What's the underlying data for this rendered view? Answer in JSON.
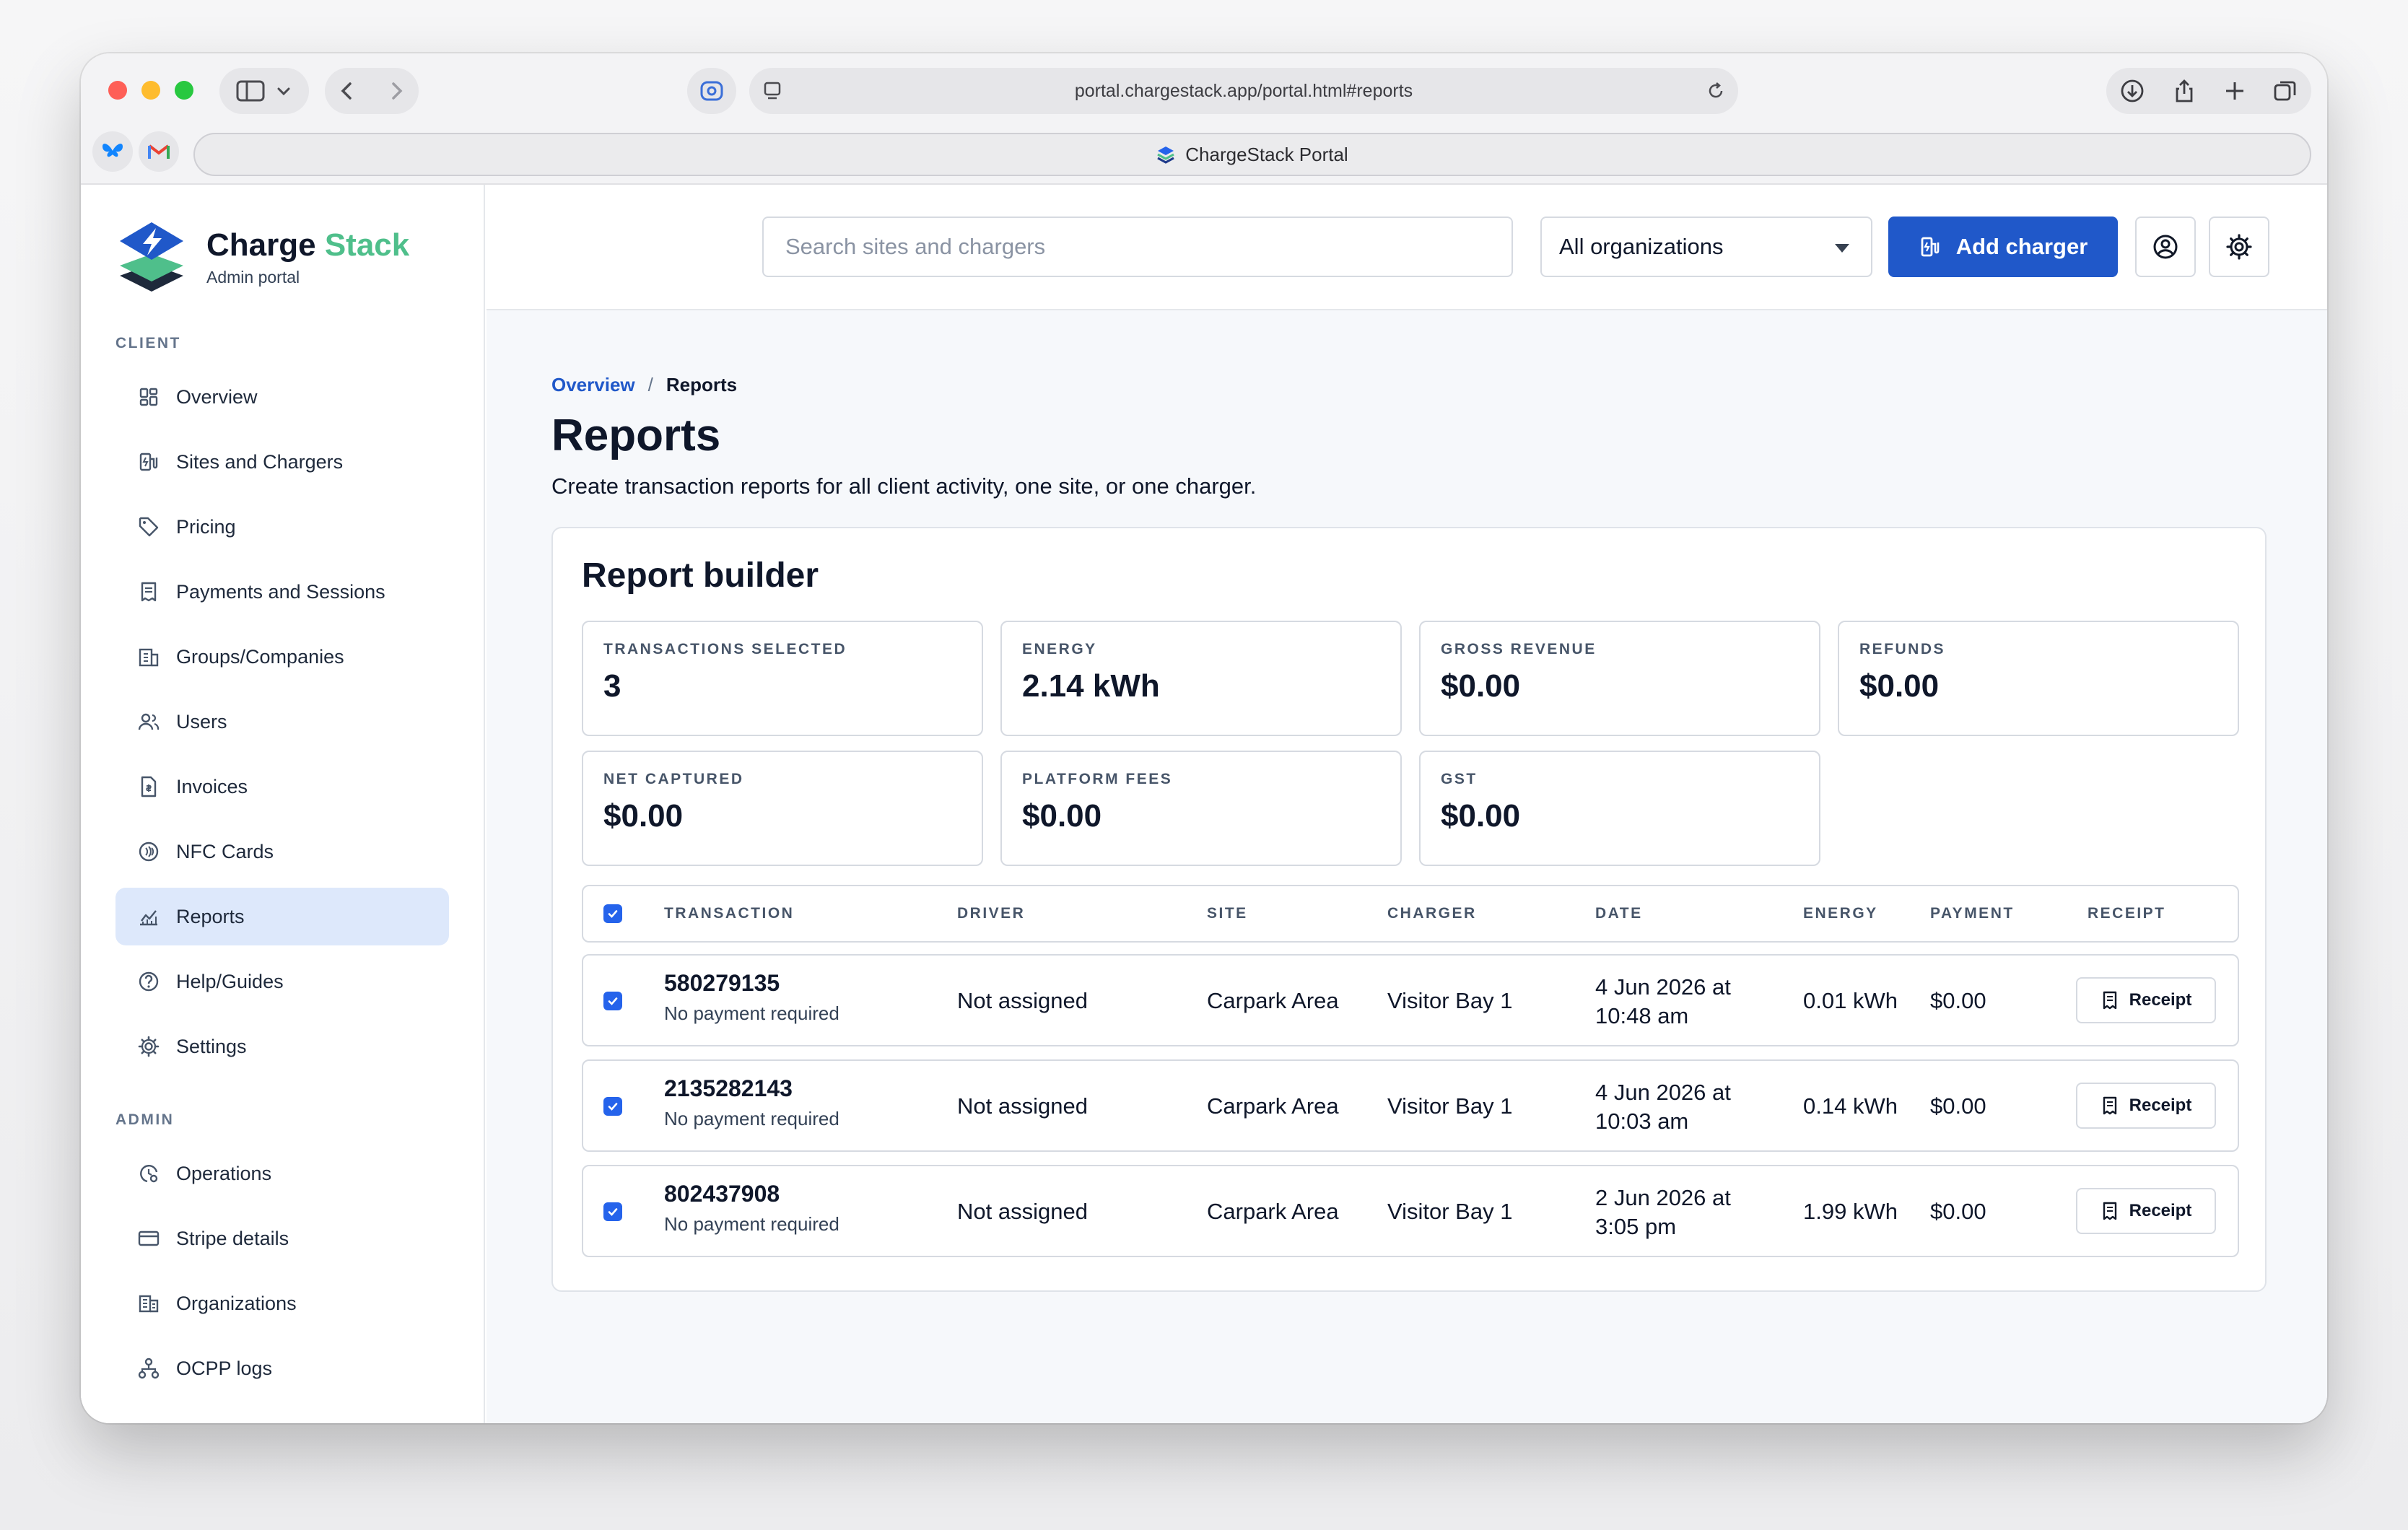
{
  "browser": {
    "url": "portal.chargestack.app/portal.html#reports",
    "tab_title": "ChargeStack Portal"
  },
  "brand": {
    "name_part1": "Charge",
    "name_part2": "Stack",
    "subtitle": "Admin portal",
    "accent_color": "#4fbf8b",
    "logo_icon": "layered-bolt-logo-icon"
  },
  "sidebar": {
    "client_label": "CLIENT",
    "client_items": [
      {
        "label": "Overview",
        "icon": "dashboard-grid-icon"
      },
      {
        "label": "Sites and Chargers",
        "icon": "charger-icon"
      },
      {
        "label": "Pricing",
        "icon": "tag-icon"
      },
      {
        "label": "Payments and Sessions",
        "icon": "receipt-icon"
      },
      {
        "label": "Groups/Companies",
        "icon": "building-icon"
      },
      {
        "label": "Users",
        "icon": "users-icon"
      },
      {
        "label": "Invoices",
        "icon": "invoice-icon"
      },
      {
        "label": "NFC Cards",
        "icon": "nfc-icon"
      },
      {
        "label": "Reports",
        "icon": "chart-icon",
        "active": true
      },
      {
        "label": "Help/Guides",
        "icon": "help-icon"
      },
      {
        "label": "Settings",
        "icon": "gear-icon"
      }
    ],
    "admin_label": "ADMIN",
    "admin_items": [
      {
        "label": "Operations",
        "icon": "operations-icon"
      },
      {
        "label": "Stripe details",
        "icon": "credit-card-icon"
      },
      {
        "label": "Organizations",
        "icon": "organizations-icon"
      },
      {
        "label": "OCPP logs",
        "icon": "network-icon"
      }
    ]
  },
  "topbar": {
    "search_placeholder": "Search sites and chargers",
    "org_selected": "All organizations",
    "add_charger_label": "Add charger",
    "primary_color": "#2058c9"
  },
  "breadcrumb": {
    "root": "Overview",
    "separator": "/",
    "current": "Reports"
  },
  "page": {
    "title": "Reports",
    "subtitle": "Create transaction reports for all client activity, one site, or one charger."
  },
  "report_builder": {
    "title": "Report builder",
    "stats": [
      {
        "label": "TRANSACTIONS SELECTED",
        "value": "3"
      },
      {
        "label": "ENERGY",
        "value": "2.14 kWh"
      },
      {
        "label": "GROSS REVENUE",
        "value": "$0.00"
      },
      {
        "label": "REFUNDS",
        "value": "$0.00"
      },
      {
        "label": "NET CAPTURED",
        "value": "$0.00"
      },
      {
        "label": "PLATFORM FEES",
        "value": "$0.00"
      },
      {
        "label": "GST",
        "value": "$0.00"
      }
    ],
    "columns": [
      "TRANSACTION",
      "DRIVER",
      "SITE",
      "CHARGER",
      "DATE",
      "ENERGY",
      "PAYMENT",
      "RECEIPT"
    ],
    "rows": [
      {
        "id": "580279135",
        "note": "No payment required",
        "driver": "Not assigned",
        "site": "Carpark Area",
        "charger": "Visitor Bay 1",
        "date_line1": "4 Jun 2026 at",
        "date_line2": "10:48 am",
        "energy": "0.01 kWh",
        "payment": "$0.00",
        "receipt_label": "Receipt"
      },
      {
        "id": "2135282143",
        "note": "No payment required",
        "driver": "Not assigned",
        "site": "Carpark Area",
        "charger": "Visitor Bay 1",
        "date_line1": "4 Jun 2026 at",
        "date_line2": "10:03 am",
        "energy": "0.14 kWh",
        "payment": "$0.00",
        "receipt_label": "Receipt"
      },
      {
        "id": "802437908",
        "note": "No payment required",
        "driver": "Not assigned",
        "site": "Carpark Area",
        "charger": "Visitor Bay 1",
        "date_line1": "2 Jun 2026 at",
        "date_line2": "3:05 pm",
        "energy": "1.99 kWh",
        "payment": "$0.00",
        "receipt_label": "Receipt"
      }
    ]
  }
}
